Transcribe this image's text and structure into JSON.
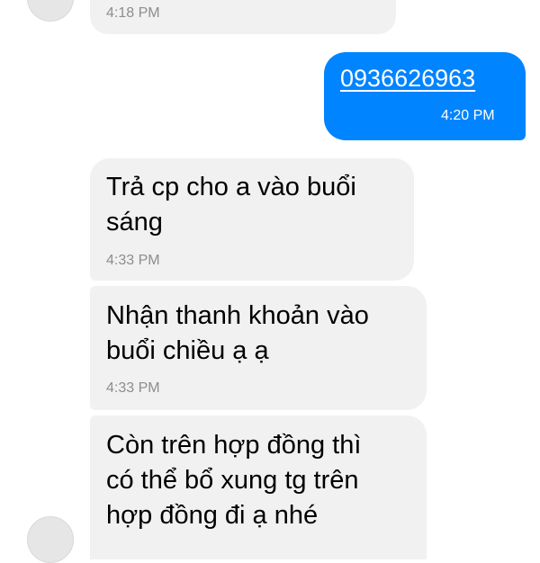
{
  "messages": [
    {
      "direction": "incoming",
      "text_lines": [],
      "time": "4:18 PM"
    },
    {
      "direction": "outgoing",
      "text_lines": [
        "0936626963"
      ],
      "time": "4:20 PM",
      "is_link": true
    },
    {
      "direction": "incoming",
      "text_lines": [
        "Trả cp cho a vào buổi",
        "sáng"
      ],
      "time": "4:33 PM"
    },
    {
      "direction": "incoming",
      "text_lines": [
        "Nhận thanh khoản vào",
        "buổi chiều ạ ạ"
      ],
      "time": "4:33 PM"
    },
    {
      "direction": "incoming",
      "text_lines": [
        "Còn trên hợp đồng thì",
        "có thể bổ xung tg trên",
        "hợp đồng đi ạ nhé"
      ],
      "time": null
    }
  ],
  "colors": {
    "incoming_bubble": "#f1f1f1",
    "outgoing_bubble": "#0084ff",
    "timestamp": "#8d8d8d"
  }
}
